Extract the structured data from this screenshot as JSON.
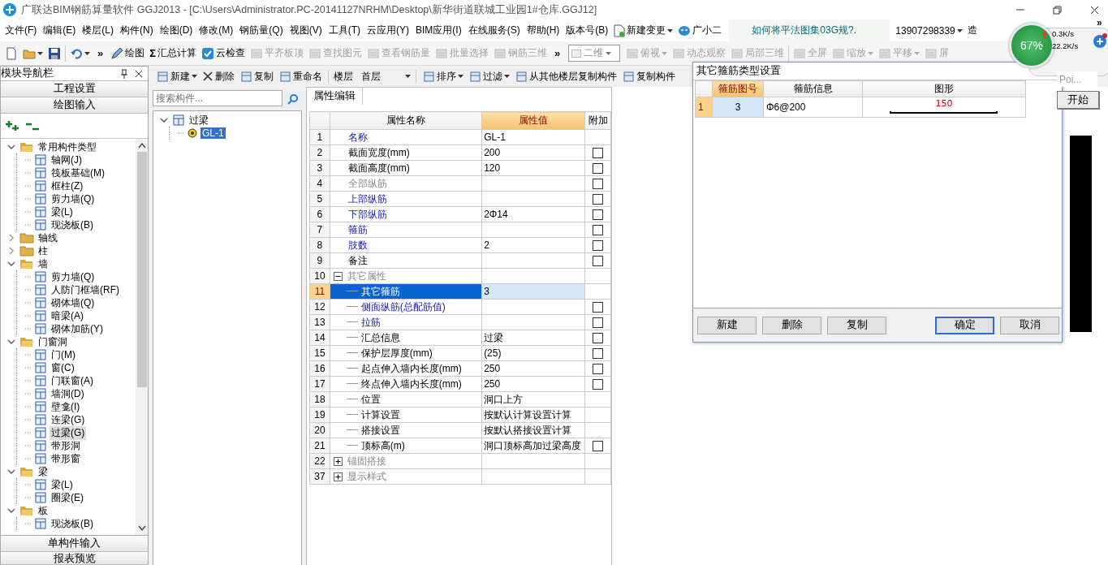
{
  "window": {
    "title": "广联达BIM钢筋算量软件 GGJ2013 - [C:\\Users\\Administrator.PC-20141127NRHM\\Desktop\\新华街道联城工业园1#仓库.GGJ12]"
  },
  "menu": [
    "文件(F)",
    "编辑(E)",
    "楼层(L)",
    "构件(N)",
    "绘图(D)",
    "修改(M)",
    "钢筋量(Q)",
    "视图(V)",
    "工具(T)",
    "云应用(Y)",
    "BIM应用(I)",
    "在线服务(S)",
    "帮助(H)",
    "版本号(B)"
  ],
  "menu_extras": {
    "change": "新建变更",
    "assistant": "广小二",
    "tip": "如何将平法图集03G规?.",
    "account": "13907298339",
    "more": "造"
  },
  "net_widget": {
    "percent": "67%",
    "upload": "0.3K/s",
    "download": "22.2K/s",
    "overflow": "»"
  },
  "toolbar": [
    {
      "kind": "icon"
    },
    {
      "kind": "icon-menu"
    },
    {
      "kind": "icon"
    },
    {
      "kind": "separator"
    },
    {
      "kind": "icon-menu"
    },
    {
      "kind": "overflow",
      "label": "»"
    },
    {
      "kind": "button",
      "label": "绘图",
      "disabled": false
    },
    {
      "kind": "glyph-button",
      "glyph": "Σ",
      "label": "汇总计算",
      "disabled": false
    },
    {
      "kind": "button",
      "label": "云检查",
      "disabled": false
    },
    {
      "kind": "button",
      "label": "平齐板顶",
      "disabled": true
    },
    {
      "kind": "button",
      "label": "查找图元",
      "disabled": true
    },
    {
      "kind": "button",
      "label": "查看钢筋量",
      "disabled": true
    },
    {
      "kind": "button",
      "label": "批量选择",
      "disabled": true
    },
    {
      "kind": "button",
      "label": "钢筋三维",
      "disabled": true
    },
    {
      "kind": "overflow",
      "label": "»"
    },
    {
      "kind": "select",
      "value": "二维"
    },
    {
      "kind": "button-menu",
      "label": "俯视",
      "disabled": true
    },
    {
      "kind": "button",
      "label": "动态观察",
      "disabled": true
    },
    {
      "kind": "button",
      "label": "局部三维",
      "disabled": true
    },
    {
      "kind": "separator"
    },
    {
      "kind": "button",
      "label": "全屏",
      "disabled": true
    },
    {
      "kind": "button-menu",
      "label": "缩放",
      "disabled": true
    },
    {
      "kind": "button-menu",
      "label": "平移",
      "disabled": true
    },
    {
      "kind": "button",
      "label": "屏",
      "disabled": true
    }
  ],
  "nav": {
    "title": "模块导航栏",
    "sections_top": [
      "工程设置",
      "绘图输入"
    ],
    "tree": [
      {
        "label": "常用构件类型",
        "expanded": true,
        "selected": false,
        "children": [
          {
            "label": "轴网(J)",
            "selected": false
          },
          {
            "label": "筏板基础(M)",
            "selected": false
          },
          {
            "label": "框柱(Z)",
            "selected": false
          },
          {
            "label": "剪力墙(Q)",
            "selected": false
          },
          {
            "label": "梁(L)",
            "selected": false
          },
          {
            "label": "现浇板(B)",
            "selected": false
          }
        ]
      },
      {
        "label": "轴线",
        "expanded": false,
        "selected": false
      },
      {
        "label": "柱",
        "expanded": false,
        "selected": false
      },
      {
        "label": "墙",
        "expanded": true,
        "selected": false,
        "children": [
          {
            "label": "剪力墙(Q)",
            "selected": false
          },
          {
            "label": "人防门框墙(RF)",
            "selected": false
          },
          {
            "label": "砌体墙(Q)",
            "selected": false
          },
          {
            "label": "暗梁(A)",
            "selected": false
          },
          {
            "label": "砌体加筋(Y)",
            "selected": false
          }
        ]
      },
      {
        "label": "门窗洞",
        "expanded": true,
        "selected": false,
        "children": [
          {
            "label": "门(M)",
            "selected": false
          },
          {
            "label": "窗(C)",
            "selected": false
          },
          {
            "label": "门联窗(A)",
            "selected": false
          },
          {
            "label": "墙洞(D)",
            "selected": false
          },
          {
            "label": "壁龛(I)",
            "selected": false
          },
          {
            "label": "连梁(G)",
            "selected": false
          },
          {
            "label": "过梁(G)",
            "selected": true
          },
          {
            "label": "带形洞",
            "selected": false
          },
          {
            "label": "带形窗",
            "selected": false
          }
        ]
      },
      {
        "label": "梁",
        "expanded": true,
        "selected": false,
        "children": [
          {
            "label": "梁(L)",
            "selected": false
          },
          {
            "label": "圈梁(E)",
            "selected": false
          }
        ]
      },
      {
        "label": "板",
        "expanded": true,
        "selected": false,
        "children": [
          {
            "label": "现浇板(B)",
            "selected": false
          }
        ]
      }
    ],
    "sections_bottom": [
      "单构件输入",
      "报表预览"
    ]
  },
  "toolbar2": [
    {
      "kind": "button-menu",
      "label": "新建"
    },
    {
      "kind": "delete",
      "label": "删除"
    },
    {
      "kind": "button",
      "label": "复制"
    },
    {
      "kind": "button",
      "label": "重命名"
    },
    {
      "kind": "floor",
      "label": "楼层",
      "value": "首层"
    },
    {
      "kind": "button-menu",
      "label": "排序"
    },
    {
      "kind": "button-menu",
      "label": "过滤"
    },
    {
      "kind": "button",
      "label": "从其他楼层复制构件"
    },
    {
      "kind": "button",
      "label": "复制构件"
    }
  ],
  "components": {
    "search": {
      "placeholder": "搜索构件..."
    },
    "tree": [
      {
        "label": "过梁",
        "expanded": true,
        "selected": false,
        "children": [
          {
            "label": "GL-1",
            "selected": true
          }
        ]
      }
    ]
  },
  "properties": {
    "tab": "属性编辑",
    "columns": [
      "属性名称",
      "属性值",
      "附加"
    ],
    "rows": [
      {
        "number": "1",
        "name": "名称",
        "value": "GL-1",
        "kind": "link",
        "selected": false
      },
      {
        "number": "2",
        "name": "截面宽度(mm)",
        "value": "200",
        "kind": "plain",
        "selected": false,
        "checked": false
      },
      {
        "number": "3",
        "name": "截面高度(mm)",
        "value": "120",
        "kind": "plain",
        "selected": false,
        "checked": false
      },
      {
        "number": "4",
        "name": "全部纵筋",
        "kind": "inactive",
        "selected": false,
        "checked": false
      },
      {
        "number": "5",
        "name": "上部纵筋",
        "kind": "link",
        "selected": false,
        "checked": false
      },
      {
        "number": "6",
        "name": "下部纵筋",
        "value": "2Φ14",
        "kind": "link",
        "selected": false,
        "checked": false
      },
      {
        "number": "7",
        "name": "箍筋",
        "kind": "link",
        "selected": false,
        "checked": false
      },
      {
        "number": "8",
        "name": "肢数",
        "value": "2",
        "kind": "link",
        "selected": false,
        "checked": false
      },
      {
        "number": "9",
        "name": "备注",
        "kind": "plain",
        "selected": false,
        "checked": false
      },
      {
        "number": "10",
        "name": "其它属性",
        "kind": "inactive",
        "selected": false,
        "expanded": true,
        "children": [
          {
            "number": "11",
            "name": "其它箍筋",
            "value": "3",
            "kind": "link",
            "selected": true
          },
          {
            "number": "12",
            "name": "侧面纵筋(总配筋值)",
            "kind": "link",
            "selected": false,
            "checked": false
          },
          {
            "number": "13",
            "name": "拉筋",
            "kind": "link",
            "selected": false,
            "checked": false
          },
          {
            "number": "14",
            "name": "汇总信息",
            "value": "过梁",
            "kind": "plain",
            "selected": false,
            "checked": false
          },
          {
            "number": "15",
            "name": "保护层厚度(mm)",
            "value": "(25)",
            "kind": "plain",
            "selected": false,
            "checked": false
          },
          {
            "number": "16",
            "name": "起点伸入墙内长度(mm)",
            "value": "250",
            "kind": "plain",
            "selected": false,
            "checked": false
          },
          {
            "number": "17",
            "name": "终点伸入墙内长度(mm)",
            "value": "250",
            "kind": "plain",
            "selected": false,
            "checked": false
          },
          {
            "number": "18",
            "name": "位置",
            "value": "洞口上方",
            "kind": "plain",
            "selected": false
          },
          {
            "number": "19",
            "name": "计算设置",
            "value": "按默认计算设置计算",
            "kind": "plain",
            "selected": false
          },
          {
            "number": "20",
            "name": "搭接设置",
            "value": "按默认搭接设置计算",
            "kind": "plain",
            "selected": false
          },
          {
            "number": "21",
            "name": "顶标高(m)",
            "value": "洞口顶标高加过梁高度",
            "kind": "plain",
            "selected": false,
            "checked": false
          }
        ]
      },
      {
        "number": "22",
        "name": "锚固搭接",
        "kind": "inactive",
        "selected": false,
        "expanded": false
      },
      {
        "number": "37",
        "name": "显示样式",
        "kind": "inactive",
        "selected": false,
        "expanded": false
      }
    ]
  },
  "dialog": {
    "title": "其它箍筋类型设置",
    "columns": [
      "箍筋图号",
      "箍筋信息",
      "图形"
    ],
    "rows": [
      {
        "number": "1",
        "shape_no": "3",
        "info": "Φ6@200",
        "length": "150",
        "selected": true
      }
    ],
    "buttons": [
      {
        "label": "新建",
        "default": false
      },
      {
        "label": "删除",
        "default": false
      },
      {
        "label": "复制",
        "default": false
      },
      {
        "label": "确定",
        "default": true
      },
      {
        "label": "取消",
        "default": false
      }
    ]
  },
  "floating": {
    "field": "Poi...",
    "button": "开始"
  }
}
